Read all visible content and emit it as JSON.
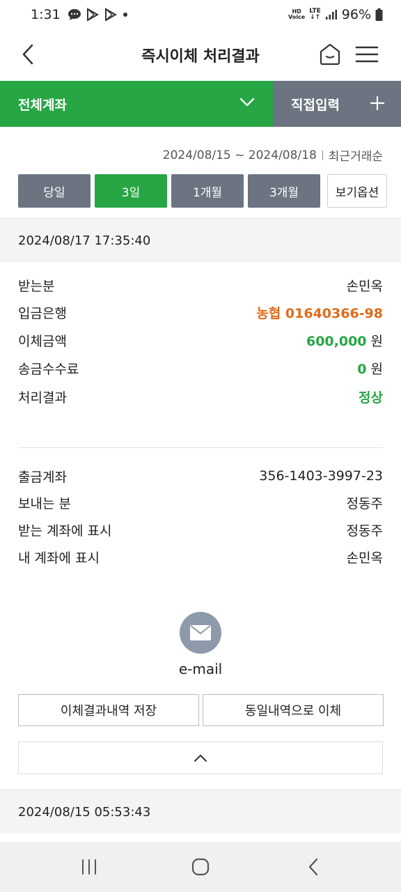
{
  "status_bar": {
    "time": "1:31",
    "notification_icons": [
      "chat-bubble-icon",
      "play-store-icon",
      "play-store-icon",
      "dot-icon"
    ],
    "hd_label": "HD",
    "voice_label": "Voice",
    "network": "LTE",
    "battery": "96%"
  },
  "header": {
    "title": "즉시이체 처리결과"
  },
  "account_bar": {
    "account_label": "전체계좌",
    "direct_input_label": "직접입력"
  },
  "filter": {
    "date_range": "2024/08/15 ~ 2024/08/18",
    "sort_order": "최근거래순",
    "periods": [
      "당일",
      "3일",
      "1개월",
      "3개월"
    ],
    "active_period": "3일",
    "view_option": "보기옵션"
  },
  "transactions": [
    {
      "datetime": "2024/08/17 17:35:40",
      "details": [
        {
          "label": "받는분",
          "value": "손민옥"
        },
        {
          "label": "입금은행",
          "value": "농협 01640366-98"
        },
        {
          "label": "이체금액",
          "value": "600,000",
          "unit": "원"
        },
        {
          "label": "송금수수료",
          "value": "0",
          "unit": "원"
        },
        {
          "label": "처리결과",
          "value": "정상"
        }
      ],
      "account_info": [
        {
          "label": "출금계좌",
          "value": "356-1403-3997-23"
        },
        {
          "label": "보내는 분",
          "value": "정동주"
        },
        {
          "label": "받는 계좌에 표시",
          "value": "정동주"
        },
        {
          "label": "내 계좌에 표시",
          "value": "손민옥"
        }
      ],
      "email_label": "e-mail",
      "save_button": "이체결과내역 저장",
      "repeat_button": "동일내역으로 이체"
    },
    {
      "datetime": "2024/08/15 05:53:43"
    }
  ],
  "colors": {
    "accent_green": "#26a644",
    "slate_gray": "#6b7480",
    "orange": "#e06b1b",
    "mail_gray": "#8d9aab"
  }
}
